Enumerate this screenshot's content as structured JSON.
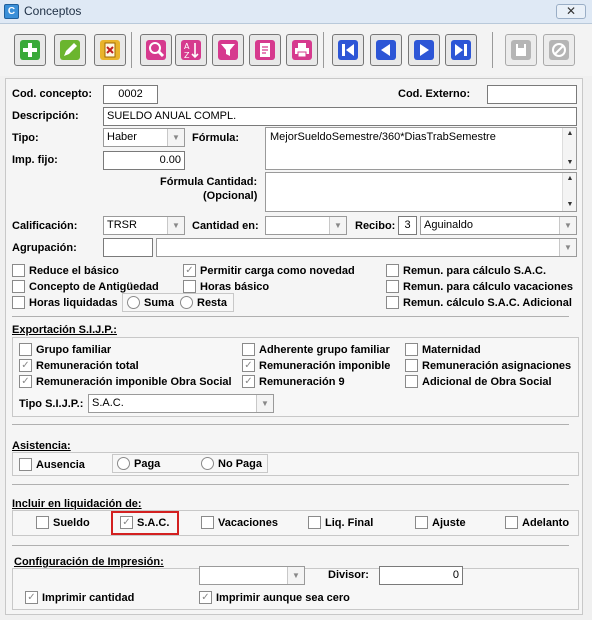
{
  "window": {
    "title": "Conceptos",
    "close_glyph": "✕",
    "app_icon_glyph": "C"
  },
  "toolbar": {
    "buttons": [
      {
        "name": "add-icon",
        "color": "#3aa93a"
      },
      {
        "name": "edit-icon",
        "color": "#5aa02a"
      },
      {
        "name": "delete-icon",
        "color": "#e4a61c"
      },
      {
        "name": "search-icon",
        "color": "#d02c84"
      },
      {
        "name": "sort-az-icon",
        "color": "#d02c84"
      },
      {
        "name": "filter-icon",
        "color": "#d02c84"
      },
      {
        "name": "report-icon",
        "color": "#d02c84"
      },
      {
        "name": "print-icon",
        "color": "#d02c84"
      },
      {
        "name": "first-record-icon",
        "color": "#2a4fd1"
      },
      {
        "name": "previous-record-icon",
        "color": "#2a4fd1"
      },
      {
        "name": "next-record-icon",
        "color": "#2a4fd1"
      },
      {
        "name": "last-record-icon",
        "color": "#2a4fd1"
      },
      {
        "name": "save-icon",
        "color": "#b5b5b5"
      },
      {
        "name": "cancel-icon",
        "color": "#b5b5b5"
      }
    ]
  },
  "form": {
    "cod_concepto": {
      "label": "Cod. concepto:",
      "value": "0002"
    },
    "cod_externo": {
      "label": "Cod. Externo:",
      "value": ""
    },
    "descripcion": {
      "label": "Descripción:",
      "value": "SUELDO ANUAL COMPL."
    },
    "tipo": {
      "label": "Tipo:",
      "value": "Haber"
    },
    "formula": {
      "label": "Fórmula:",
      "value": "MejorSueldoSemestre/360*DiasTrabSemestre"
    },
    "imp_fijo": {
      "label": "Imp. fijo:",
      "value": "0.00"
    },
    "formula_cantidad": {
      "label1": "Fórmula Cantidad:",
      "label2": "(Opcional)",
      "value": ""
    },
    "calificacion": {
      "label": "Calificación:",
      "value": "TRSR"
    },
    "cantidad_en": {
      "label": "Cantidad en:",
      "value": ""
    },
    "recibo": {
      "label": "Recibo:",
      "number": "3",
      "value": "Aguinaldo"
    },
    "agrupacion": {
      "label": "Agrupación:",
      "code": "",
      "value": ""
    }
  },
  "checks": {
    "reduce_basico": "Reduce el básico",
    "concepto_antiguedad": "Concepto de Antigüedad",
    "horas_liquidadas": "Horas liquidadas",
    "suma": "Suma",
    "resta": "Resta",
    "permitir_carga": "Permitir carga como novedad",
    "horas_basico": "Horas básico",
    "remun_sac": "Remun. para cálculo S.A.C.",
    "remun_vacaciones": "Remun. para cálculo vacaciones",
    "remun_sac_adicional": "Remun. cálculo S.A.C. Adicional"
  },
  "sijp": {
    "title": "Exportación S.I.J.P.:",
    "grupo_familiar": "Grupo familiar",
    "remuneracion_total": "Remuneración total",
    "remuneracion_obra_social": "Remuneración imponible Obra Social",
    "adherente": "Adherente grupo familiar",
    "remuneracion_imponible": "Remuneración imponible",
    "remuneracion_9": "Remuneración 9",
    "maternidad": "Maternidad",
    "remuneracion_asignaciones": "Remuneración asignaciones",
    "adicional_obra_social": "Adicional de Obra Social",
    "tipo_label": "Tipo S.I.J.P.:",
    "tipo_value": "S.A.C."
  },
  "asistencia": {
    "title": "Asistencia:",
    "ausencia": "Ausencia",
    "paga": "Paga",
    "no_paga": "No Paga"
  },
  "liquidacion": {
    "title": "Incluir en liquidación de:",
    "sueldo": "Sueldo",
    "sac": "S.A.C.",
    "vacaciones": "Vacaciones",
    "liq_final": "Liq. Final",
    "ajuste": "Ajuste",
    "adelanto": "Adelanto"
  },
  "impresion": {
    "title": "Configuración de Impresión:",
    "combo_value": "",
    "divisor_label": "Divisor:",
    "divisor_value": "0",
    "imprimir_cantidad": "Imprimir cantidad",
    "imprimir_cero": "Imprimir aunque sea cero"
  },
  "glyphs": {
    "check": "✓",
    "arrow_down": "▼",
    "arrow_up": "▲"
  }
}
